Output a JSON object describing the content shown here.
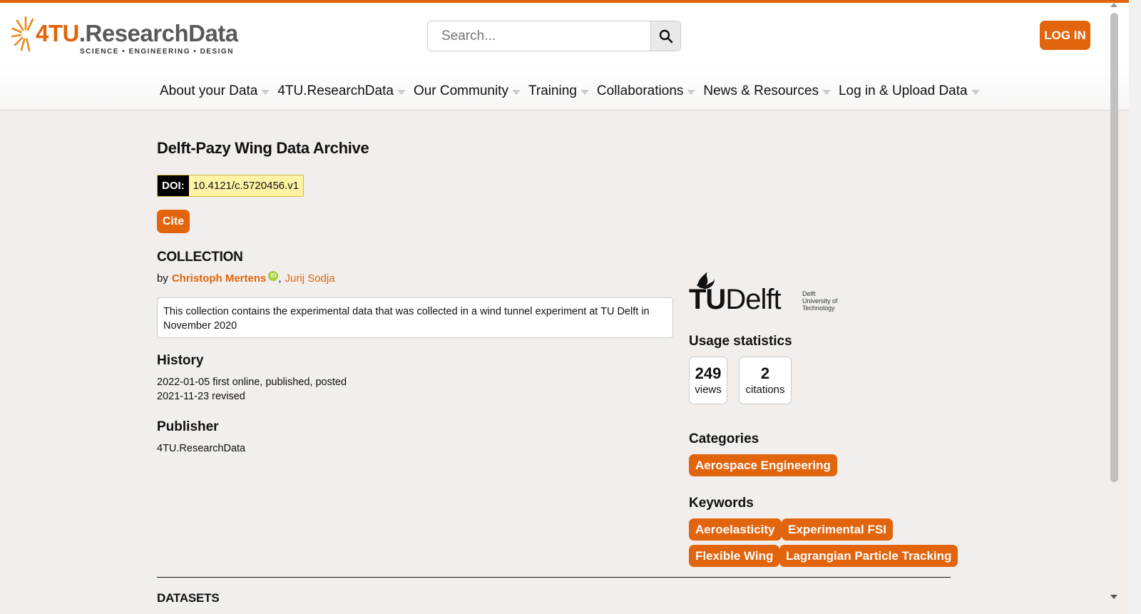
{
  "header": {
    "logo_main_prefix": "4TU",
    "logo_main_suffix": ".ResearchData",
    "logo_sub": "SCIENCE • ENGINEERING • DESIGN",
    "search_placeholder": "Search...",
    "login_label": "LOG IN"
  },
  "nav": {
    "items": [
      {
        "label": "About your Data"
      },
      {
        "label": "4TU.ResearchData"
      },
      {
        "label": "Our Community"
      },
      {
        "label": "Training"
      },
      {
        "label": "Collaborations"
      },
      {
        "label": "News & Resources"
      },
      {
        "label": "Log in & Upload Data"
      }
    ]
  },
  "collection": {
    "title": "Delft-Pazy Wing Data Archive",
    "doi_label": "DOI:",
    "doi_value": "10.4121/c.5720456.v1",
    "cite_label": "Cite",
    "type_label": "COLLECTION",
    "by_label": "by",
    "authors": [
      "Christoph Mertens",
      "Jurij Sodja"
    ],
    "author_separator": ",",
    "orcid_label": "iD",
    "description": "This collection contains the experimental data that was collected in a wind tunnel experiment at TU Delft in November 2020",
    "history_heading": "History",
    "history": [
      "2022-01-05 first online, published, posted",
      "2021-11-23 revised"
    ],
    "publisher_heading": "Publisher",
    "publisher": "4TU.ResearchData",
    "datasets_heading": "DATASETS"
  },
  "sidebar": {
    "institution_logo": {
      "name": "TU Delft",
      "mark_tu": "TU",
      "mark_delft": "Delft",
      "subtitle_lines": [
        "Delft",
        "University of",
        "Technology"
      ]
    },
    "usage_heading": "Usage statistics",
    "views_value": "249",
    "views_label": "views",
    "citations_value": "2",
    "citations_label": "citations",
    "categories_heading": "Categories",
    "categories": [
      "Aerospace Engineering"
    ],
    "keywords_heading": "Keywords",
    "keywords": [
      "Aeroelasticity",
      "Experimental FSI",
      "Flexible Wing",
      "Lagrangian Particle Tracking"
    ]
  },
  "colors": {
    "accent": "#e2640c",
    "doi_bg": "#fff3a6",
    "page_bg": "#f1eeec",
    "tud_blue": "#00a6d6"
  }
}
